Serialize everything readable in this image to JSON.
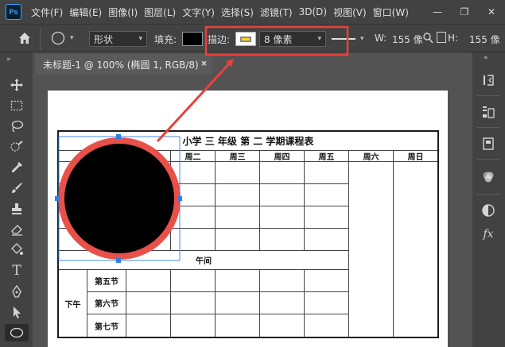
{
  "app": {
    "logo": "Ps",
    "menu": [
      "文件(F)",
      "编辑(E)",
      "图像(I)",
      "图层(L)",
      "文字(Y)",
      "选择(S)",
      "滤镜(T)",
      "3D(D)",
      "视图(V)",
      "窗口(W)"
    ],
    "window_controls": [
      "—",
      "❐",
      "✕"
    ]
  },
  "options_bar": {
    "mode_value": "形状",
    "fill_label": "填充:",
    "fill_color": "#000000",
    "stroke_label": "描边:",
    "stroke_color": "#ffd21a",
    "stroke_width_value": "8 像素",
    "w_label": "W:",
    "w_value": "155 像",
    "h_label": "H:",
    "h_value": "155 像"
  },
  "document_tab": {
    "title": "未标题-1 @ 100% (椭圆 1, RGB/8) *",
    "close": "×"
  },
  "panels": {
    "collapse_left": "»",
    "collapse_right": "«"
  },
  "schedule": {
    "title": "小学 三 年级 第 二 学期课程表",
    "days": [
      "周二",
      "周三",
      "周四",
      "周五",
      "周六",
      "周日"
    ],
    "noon_label": "午间",
    "afternoon_label": "下午",
    "afternoon_periods": [
      "第五节",
      "第六节",
      "第七节"
    ]
  },
  "colors": {
    "accent_red": "#e8413c",
    "selection_blue": "#2f7fe0",
    "ellipse_fill": "#000000",
    "ellipse_stroke": "#e8504a"
  }
}
